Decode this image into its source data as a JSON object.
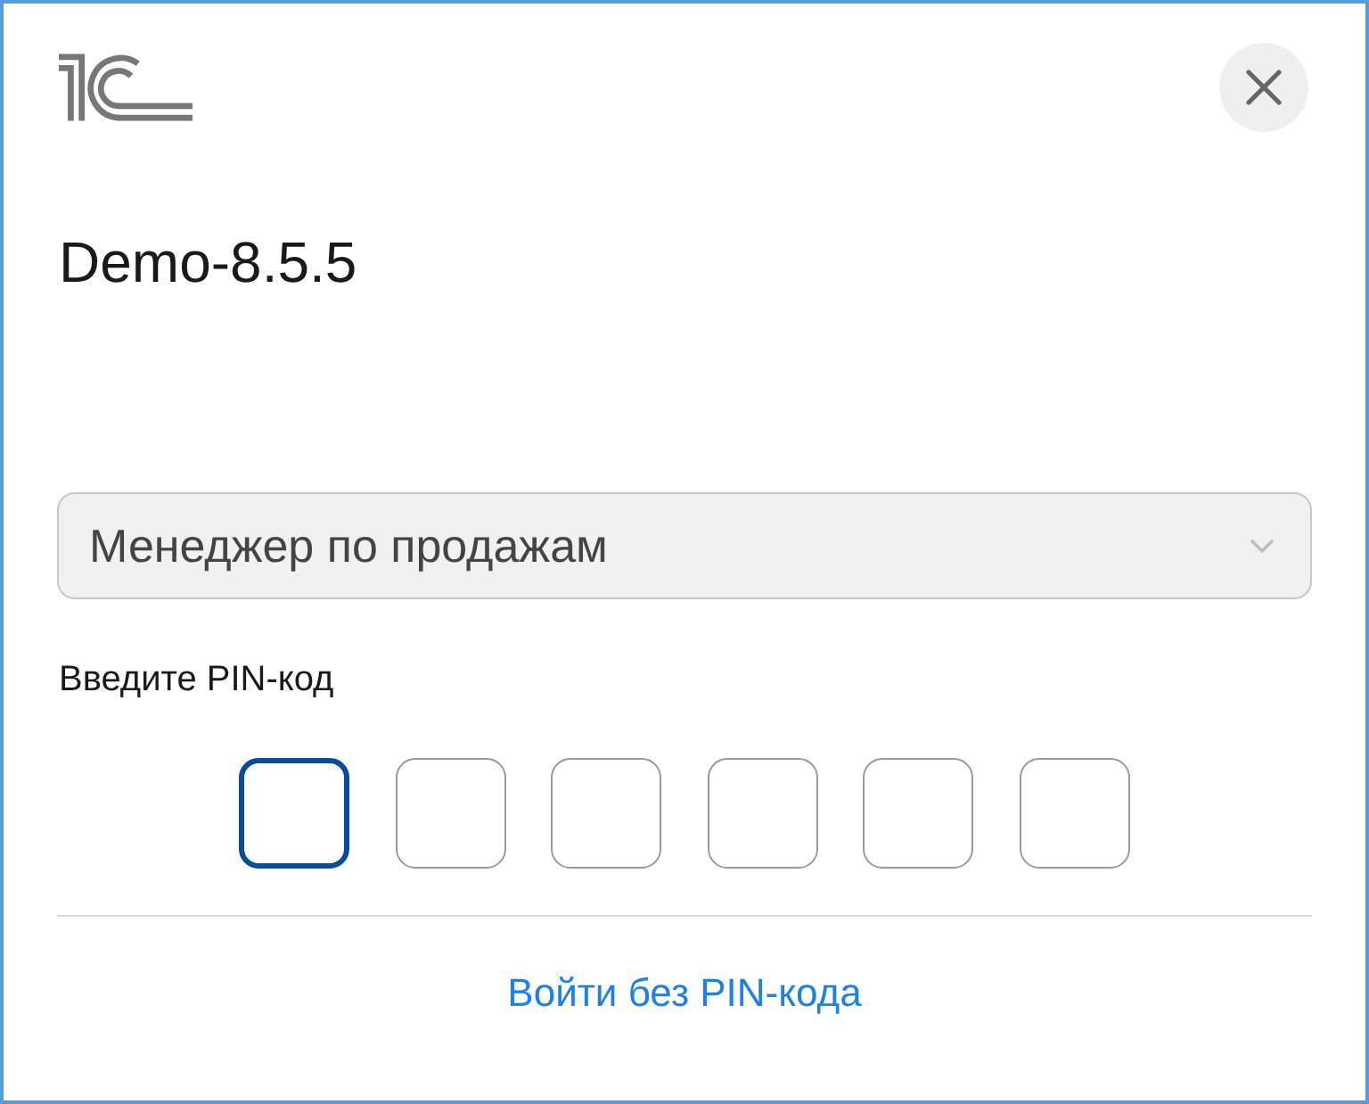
{
  "window": {
    "title": "Demo-8.5.5"
  },
  "role_select": {
    "value": "Менеджер по продажам"
  },
  "pin": {
    "label": "Введите PIN-код",
    "digits": [
      {
        "focused": true
      },
      {
        "focused": false
      },
      {
        "focused": false
      },
      {
        "focused": false
      },
      {
        "focused": false
      },
      {
        "focused": false
      }
    ]
  },
  "link": {
    "text": "Войти без PIN-кода"
  }
}
